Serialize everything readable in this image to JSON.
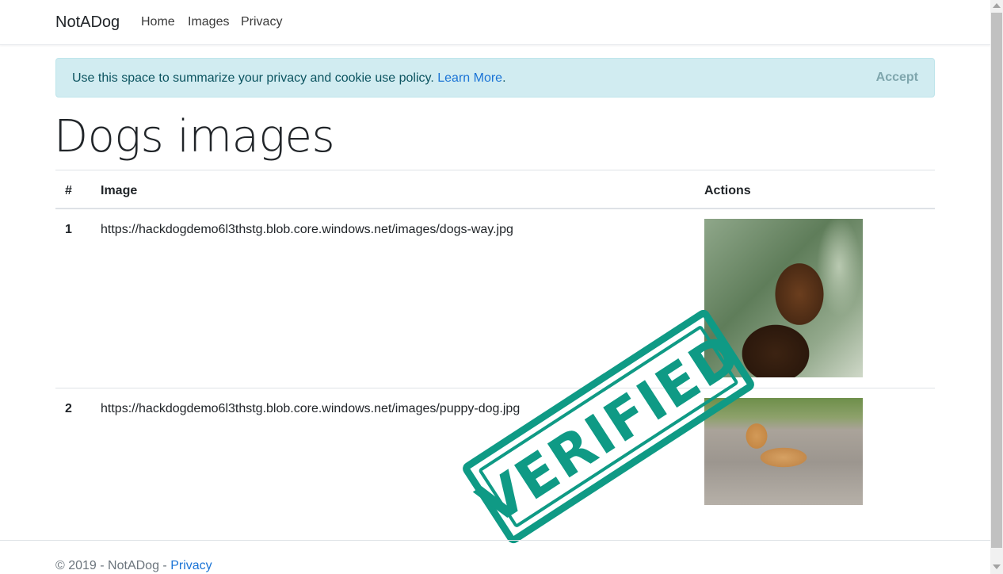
{
  "navbar": {
    "brand": "NotADog",
    "links": [
      "Home",
      "Images",
      "Privacy"
    ]
  },
  "cookie_alert": {
    "message": "Use this space to summarize your privacy and cookie use policy.",
    "link_text": "Learn More",
    "trailing": ".",
    "accept_label": "Accept"
  },
  "page": {
    "title": "Dogs images"
  },
  "table": {
    "headers": [
      "#",
      "Image",
      "Actions"
    ],
    "rows": [
      {
        "num": "1",
        "url": "https://hackdogdemo6l3thstg.blob.core.windows.net/images/dogs-way.jpg",
        "image_alt": "dogs-way"
      },
      {
        "num": "2",
        "url": "https://hackdogdemo6l3thstg.blob.core.windows.net/images/puppy-dog.jpg",
        "image_alt": "puppy-dog"
      }
    ]
  },
  "stamp": {
    "text": "VERIFIED",
    "color": "#0f9a85"
  },
  "footer": {
    "copyright": "© 2019 - NotADog - ",
    "link_text": "Privacy"
  },
  "colors": {
    "link": "#1b74d6",
    "alert_bg": "#d1ecf1",
    "alert_text": "#0c5460"
  }
}
